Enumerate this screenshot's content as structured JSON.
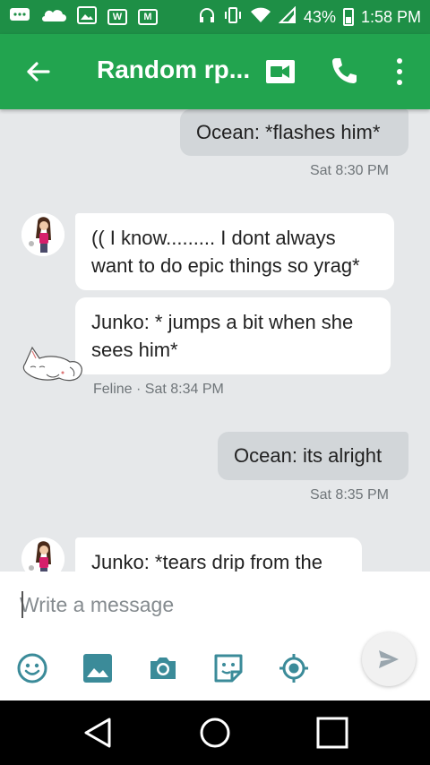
{
  "status_bar": {
    "battery": "43%",
    "time": "1:58 PM",
    "icons": [
      "chat-icon",
      "cloud-icon",
      "image-icon",
      "w-icon",
      "gmail-icon",
      "headphones-icon",
      "vibrate-icon",
      "wifi-icon",
      "signal-icon",
      "battery-icon"
    ],
    "w_label": "W",
    "gmail_label": "M"
  },
  "app_bar": {
    "title": "Random rp...",
    "icons": [
      "back-arrow-icon",
      "video-call-icon",
      "phone-icon",
      "more-vert-icon"
    ],
    "background": "#22a44f"
  },
  "messages": [
    {
      "direction": "outgoing",
      "text": "Ocean: *flashes him*",
      "meta": "Sat 8:30 PM"
    },
    {
      "direction": "incoming",
      "text": "(( I know......... I dont always want to do epic things so yrag*"
    },
    {
      "direction": "incoming",
      "text": "Junko: * jumps a bit when she sees him*",
      "meta": "Feline · Sat 8:34 PM"
    },
    {
      "direction": "outgoing",
      "text": "Ocean: its alright",
      "meta": "Sat 8:35 PM"
    },
    {
      "direction": "incoming",
      "text": "Junko: *tears drip from the"
    }
  ],
  "composer": {
    "placeholder": "Write a message",
    "tools": [
      "emoji-icon",
      "gallery-icon",
      "camera-icon",
      "sticker-icon",
      "location-icon"
    ],
    "send_icon": "send-icon"
  },
  "nav_bar": {
    "icons": [
      "nav-back-icon",
      "nav-home-icon",
      "nav-recents-icon"
    ]
  }
}
